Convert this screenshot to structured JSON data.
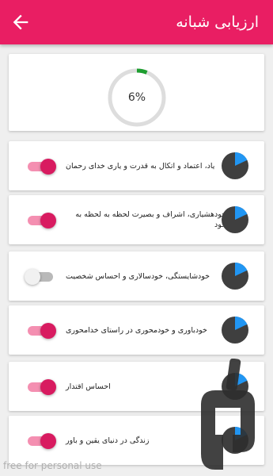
{
  "app": {
    "title": "ارزیابی شبانه",
    "back_icon": "arrow-back-icon",
    "accent": "#e91e63"
  },
  "progress": {
    "value_text": "6%",
    "fraction": 0.06,
    "track_color": "#dddddd",
    "fill_color": "#1e9e30"
  },
  "items": [
    {
      "label": "یاد، اعتماد و اتکال به قدرت و یاری خدای رحمان",
      "enabled": true,
      "pie_fraction": 0.18
    },
    {
      "label": "خودهشیاری، اشراف و بصیرت لحظه به لحظه به خود",
      "enabled": true,
      "pie_fraction": 0.18
    },
    {
      "label": "خودشایستگی، خودسالاری و احساس شخصیت",
      "enabled": false,
      "pie_fraction": 0.18
    },
    {
      "label": "خودباوری و خودمحوری در راستای خدامحوری",
      "enabled": true,
      "pie_fraction": 0.18
    },
    {
      "label": "احساس اقتدار",
      "enabled": true,
      "pie_fraction": 0.18
    },
    {
      "label": "زندگی در دنیای یقین و باور",
      "enabled": true,
      "pie_fraction": 0.18
    }
  ],
  "pie_colors": {
    "base": "#3f3f3f",
    "slice": "#2196f3"
  },
  "watermark": "free for personal use"
}
